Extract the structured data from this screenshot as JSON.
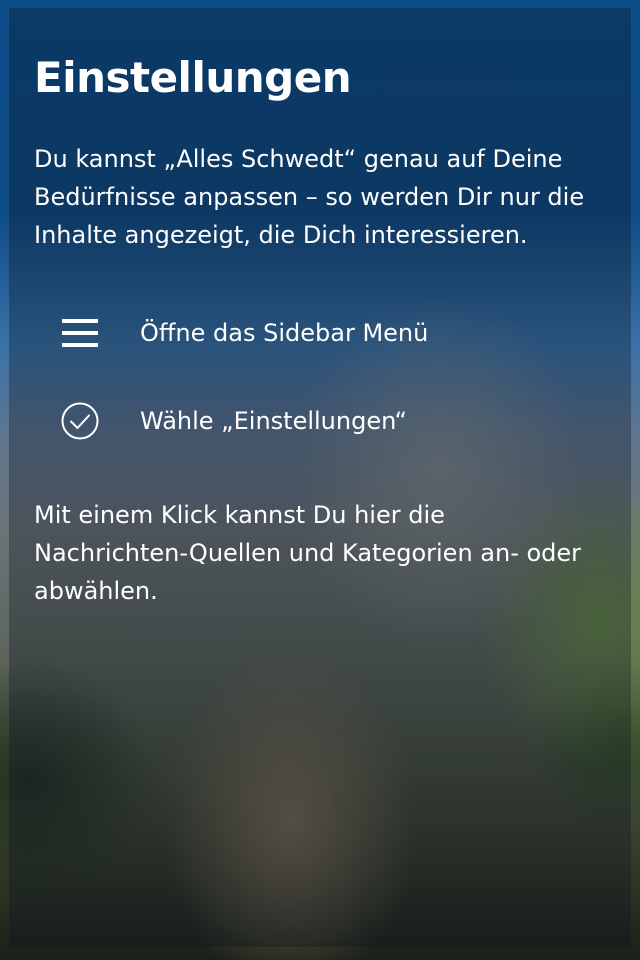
{
  "title": "Einstellungen",
  "intro": "Du kannst „Alles Schwedt“ genau auf Deine Bedürfnisse anpassen – so werden Dir nur die Inhalte angezeigt, die Dich interessieren.",
  "steps": [
    {
      "icon": "menu-icon",
      "label": "Öffne das Sidebar Menü"
    },
    {
      "icon": "check-circle-icon",
      "label": "Wähle „Einstellungen“"
    }
  ],
  "outro": "Mit einem Klick kannst Du hier die Nachrichten-Quellen und Kategorien an- oder abwählen.",
  "colors": {
    "text": "#ffffff",
    "top_blue": "#0d4d88"
  }
}
